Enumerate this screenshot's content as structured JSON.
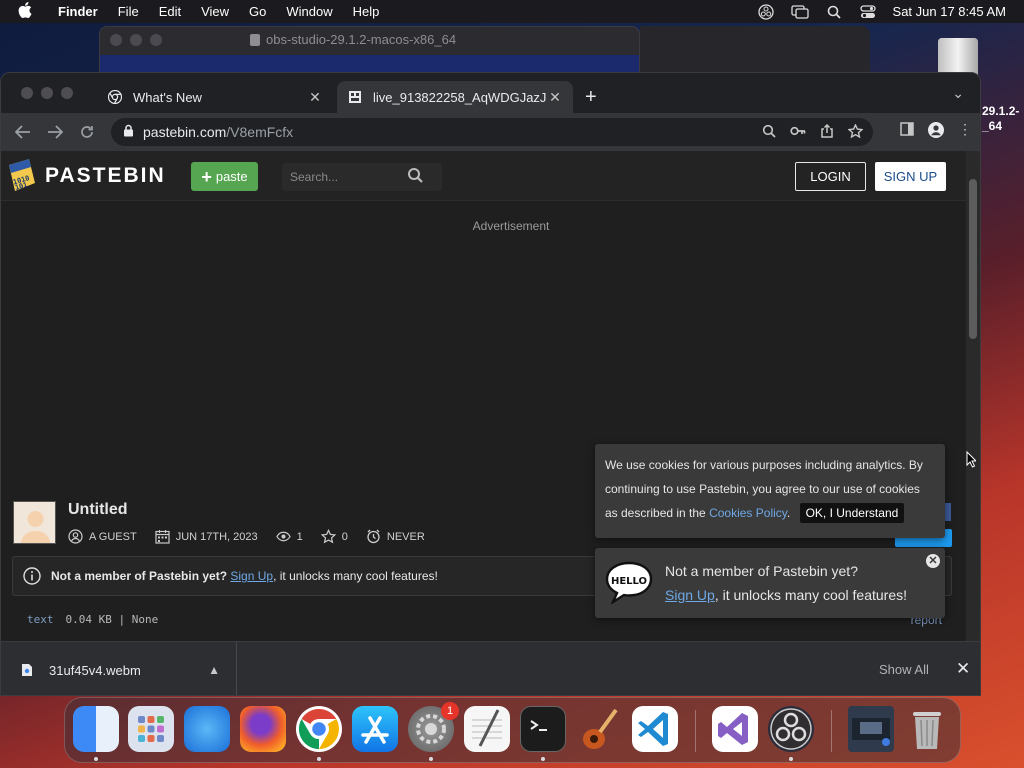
{
  "menubar": {
    "app": "Finder",
    "items": [
      "File",
      "Edit",
      "View",
      "Go",
      "Window",
      "Help"
    ],
    "clock": "Sat Jun 17  8:45 AM",
    "status_icons": [
      "obs-status-icon",
      "screen-mirroring-icon",
      "search-icon",
      "control-center-icon"
    ]
  },
  "background_window": {
    "title": "obs-studio-29.1.2-macos-x86_64"
  },
  "desktop": {
    "drive_label_line1": "29.1.2-",
    "drive_label_line2": "_64"
  },
  "browser": {
    "tabs": [
      {
        "label": "What's New",
        "active": false
      },
      {
        "label": "live_913822258_AqWDGJazJa",
        "active": true
      }
    ],
    "url_host": "pastebin.com",
    "url_path": "/V8emFcfx"
  },
  "pastebin": {
    "brand": "PASTEBIN",
    "paste_button": "paste",
    "search_placeholder": "Search...",
    "login": "LOGIN",
    "signup": "SIGN UP",
    "ad_label": "Advertisement",
    "paste_title": "Untitled",
    "meta": {
      "author": "A GUEST",
      "date": "JUN 17TH, 2023",
      "views": "1",
      "stars": "0",
      "expires": "NEVER"
    },
    "notice": {
      "bold": "Not a member of Pastebin yet?",
      "link": "Sign Up",
      "rest": ", it unlocks many cool features!"
    },
    "paste_bar": {
      "language": "text",
      "info": "0.04 KB | None",
      "report": "report"
    }
  },
  "cookie_popup": {
    "text_before": "We use cookies for various purposes including analytics. By continuing to use Pastebin, you agree to our use of cookies as described in the",
    "link": "Cookies Policy",
    "period": ".",
    "button": "OK, I Understand"
  },
  "member_popup": {
    "line1": "Not a member of Pastebin yet?",
    "link": "Sign Up",
    "rest": ", it unlocks many cool features!",
    "hello": "HELLO"
  },
  "download_shelf": {
    "file": "31uf45v4.webm",
    "show_all": "Show All"
  },
  "dock": {
    "apps": [
      "finder",
      "launchpad",
      "safari",
      "firefox",
      "chrome",
      "app-store",
      "system-settings",
      "textedit",
      "terminal",
      "garageband",
      "vscode",
      "visual-studio",
      "obs",
      "downloads-stack",
      "trash"
    ],
    "settings_badge": "1"
  }
}
